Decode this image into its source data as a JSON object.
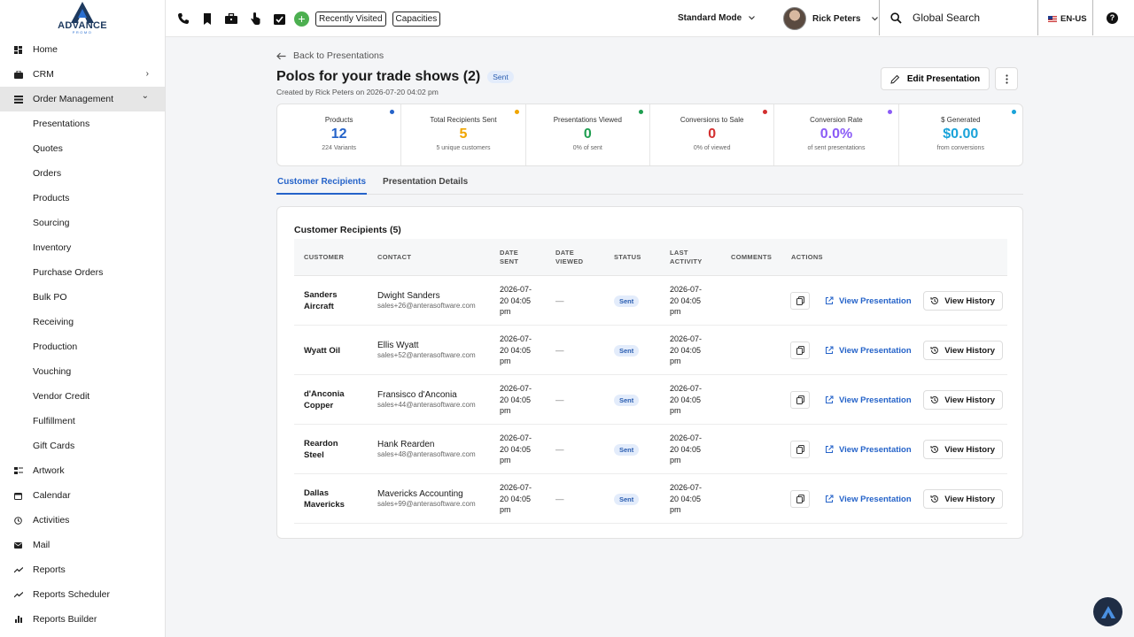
{
  "brand": {
    "name": "ADVANCE",
    "tagline": "PROMO"
  },
  "sidebar": {
    "items": [
      {
        "label": "Home",
        "icon": "dashboard-icon"
      },
      {
        "label": "CRM",
        "icon": "briefcase-icon",
        "chevron": "›"
      },
      {
        "label": "Order Management",
        "icon": "stack-icon",
        "chevron": "⌄",
        "active": true
      },
      {
        "label": "Artwork",
        "icon": "artwork-icon"
      },
      {
        "label": "Calendar",
        "icon": "calendar-icon"
      },
      {
        "label": "Activities",
        "icon": "clock-icon"
      },
      {
        "label": "Mail",
        "icon": "mail-icon"
      },
      {
        "label": "Reports",
        "icon": "trend-icon"
      },
      {
        "label": "Reports Scheduler",
        "icon": "trend-icon"
      },
      {
        "label": "Reports Builder",
        "icon": "bar-chart-icon"
      }
    ],
    "sub_items": [
      "Presentations",
      "Quotes",
      "Orders",
      "Products",
      "Sourcing",
      "Inventory",
      "Purchase Orders",
      "Bulk PO",
      "Receiving",
      "Production",
      "Vouching",
      "Vendor Credit",
      "Fulfillment",
      "Gift Cards"
    ]
  },
  "topbar": {
    "recently_visited": "Recently Visited",
    "capacities": "Capacities",
    "mode": "Standard Mode",
    "user_name": "Rick Peters",
    "search_placeholder": "Global Search",
    "language": "EN-US",
    "help": "?"
  },
  "page": {
    "back_label": "Back to Presentations",
    "title": "Polos for your trade shows (2)",
    "status": "Sent",
    "created": "Created by Rick Peters on 2026-07-20 04:02 pm",
    "edit_label": "Edit Presentation"
  },
  "stats": [
    {
      "label": "Products",
      "value": "12",
      "sub": "224 Variants",
      "color": "#2563c9",
      "dot": "#2563c9"
    },
    {
      "label": "Total Recipients Sent",
      "value": "5",
      "sub": "5 unique customers",
      "color": "#f0a500",
      "dot": "#f0a500"
    },
    {
      "label": "Presentations Viewed",
      "value": "0",
      "sub": "0% of sent",
      "color": "#1e9e50",
      "dot": "#1e9e50"
    },
    {
      "label": "Conversions to Sale",
      "value": "0",
      "sub": "0% of viewed",
      "color": "#d32f2f",
      "dot": "#d32f2f"
    },
    {
      "label": "Conversion Rate",
      "value": "0.0%",
      "sub": "of sent presentations",
      "color": "#8b5cf6",
      "dot": "#8b5cf6"
    },
    {
      "label": "$ Generated",
      "value": "$0.00",
      "sub": "from conversions",
      "color": "#1aa3d9",
      "dot": "#1aa3d9"
    }
  ],
  "tabs": [
    {
      "label": "Customer Recipients",
      "active": true
    },
    {
      "label": "Presentation Details",
      "active": false
    }
  ],
  "table": {
    "title": "Customer Recipients (5)",
    "headers": {
      "customer": "CUSTOMER",
      "contact": "CONTACT",
      "date_sent": "DATE SENT",
      "date_viewed": "DATE VIEWED",
      "status": "STATUS",
      "last_activity": "LAST ACTIVITY",
      "comments": "COMMENTS",
      "actions": "ACTIONS"
    },
    "view_label": "View Presentation",
    "history_label": "View History",
    "rows": [
      {
        "customer": "Sanders Aircraft",
        "contact": "Dwight Sanders",
        "email": "sales+26@anterasoftware.com",
        "date_sent": "2026-07-20 04:05 pm",
        "date_viewed": "—",
        "status": "Sent",
        "last_activity": "2026-07-20 04:05 pm"
      },
      {
        "customer": "Wyatt Oil",
        "contact": "Ellis Wyatt",
        "email": "sales+52@anterasoftware.com",
        "date_sent": "2026-07-20 04:05 pm",
        "date_viewed": "—",
        "status": "Sent",
        "last_activity": "2026-07-20 04:05 pm"
      },
      {
        "customer": "d'Anconia Copper",
        "contact": "Fransisco d'Anconia",
        "email": "sales+44@anterasoftware.com",
        "date_sent": "2026-07-20 04:05 pm",
        "date_viewed": "—",
        "status": "Sent",
        "last_activity": "2026-07-20 04:05 pm"
      },
      {
        "customer": "Reardon Steel",
        "contact": "Hank Rearden",
        "email": "sales+48@anterasoftware.com",
        "date_sent": "2026-07-20 04:05 pm",
        "date_viewed": "—",
        "status": "Sent",
        "last_activity": "2026-07-20 04:05 pm"
      },
      {
        "customer": "Dallas Mavericks",
        "contact": "Mavericks Accounting",
        "email": "sales+99@anterasoftware.com",
        "date_sent": "2026-07-20 04:05 pm",
        "date_viewed": "—",
        "status": "Sent",
        "last_activity": "2026-07-20 04:05 pm"
      }
    ]
  }
}
